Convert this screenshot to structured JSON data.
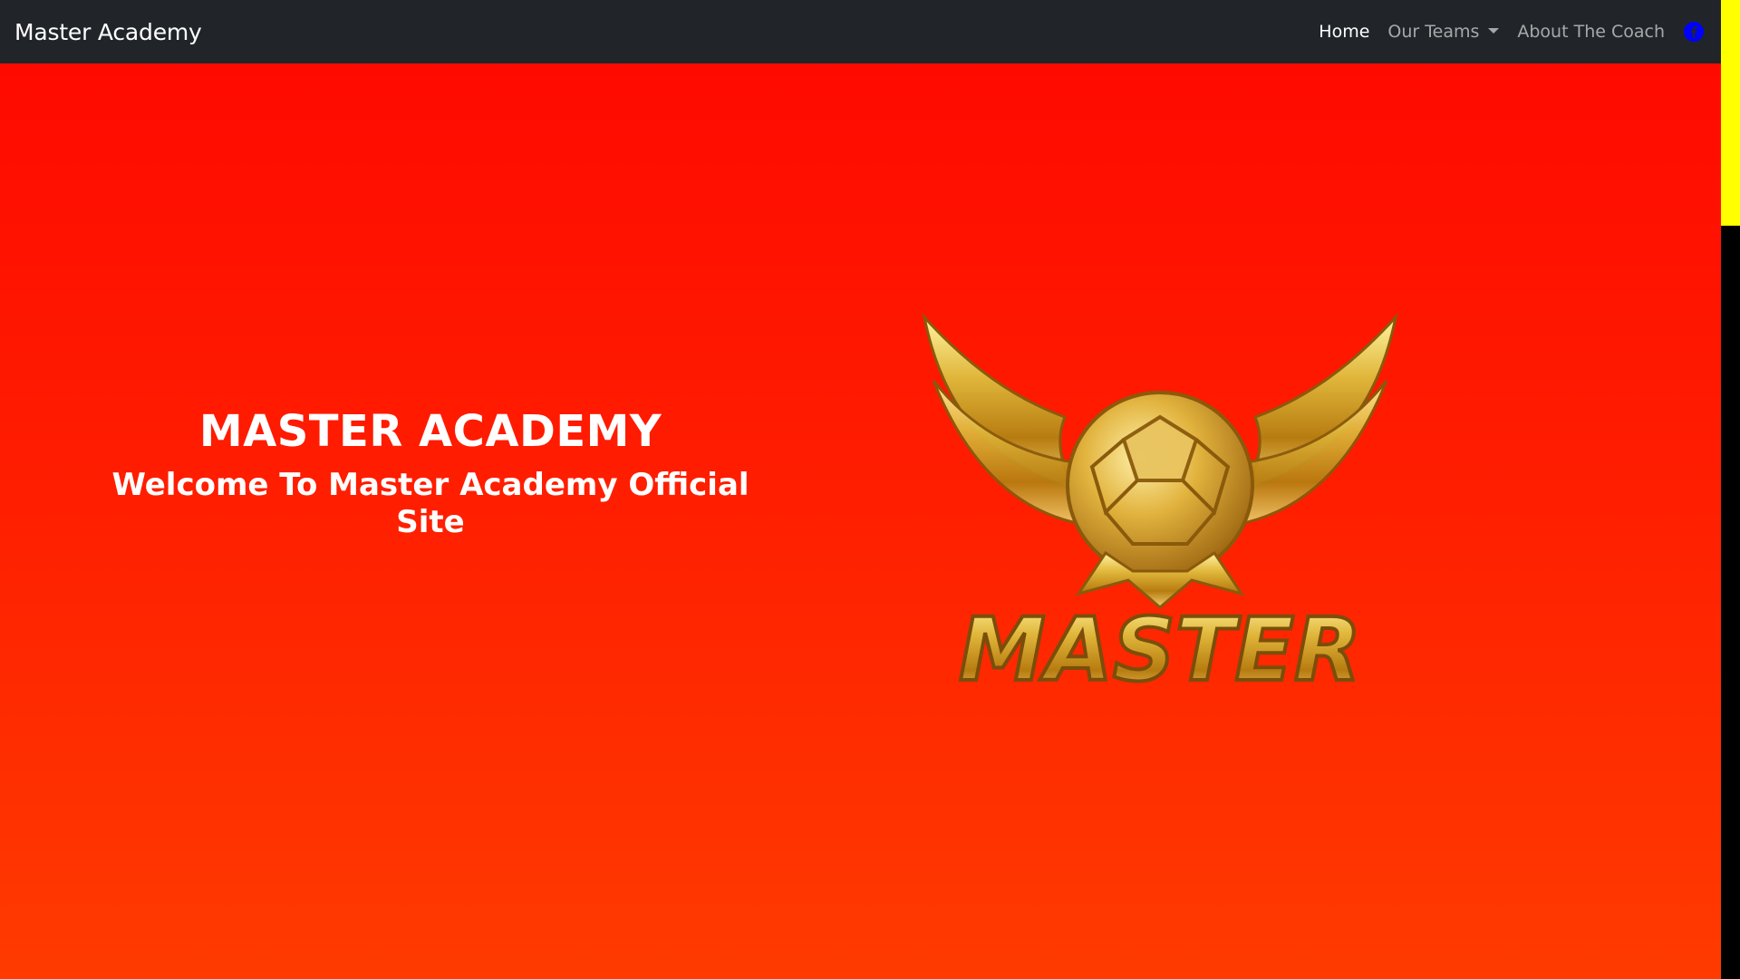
{
  "navbar": {
    "brand": "Master Academy",
    "links": [
      {
        "label": "Home"
      },
      {
        "label": "Our Teams"
      },
      {
        "label": "About The Coach"
      }
    ],
    "social_icon": "facebook-icon"
  },
  "hero": {
    "title": "MASTER ACADEMY",
    "subtitle": "Welcome To Master Academy Official Site"
  },
  "logo": {
    "text": "MASTER",
    "icon": "winged-soccer-ball-logo"
  },
  "colors": {
    "navbar_bg": "#212529",
    "hero_top": "#ff0a00",
    "hero_bottom": "#ff3b00",
    "gold": "#d4a21a",
    "scroll_thumb": "#ffff00",
    "facebook_blue": "#0000ff"
  }
}
